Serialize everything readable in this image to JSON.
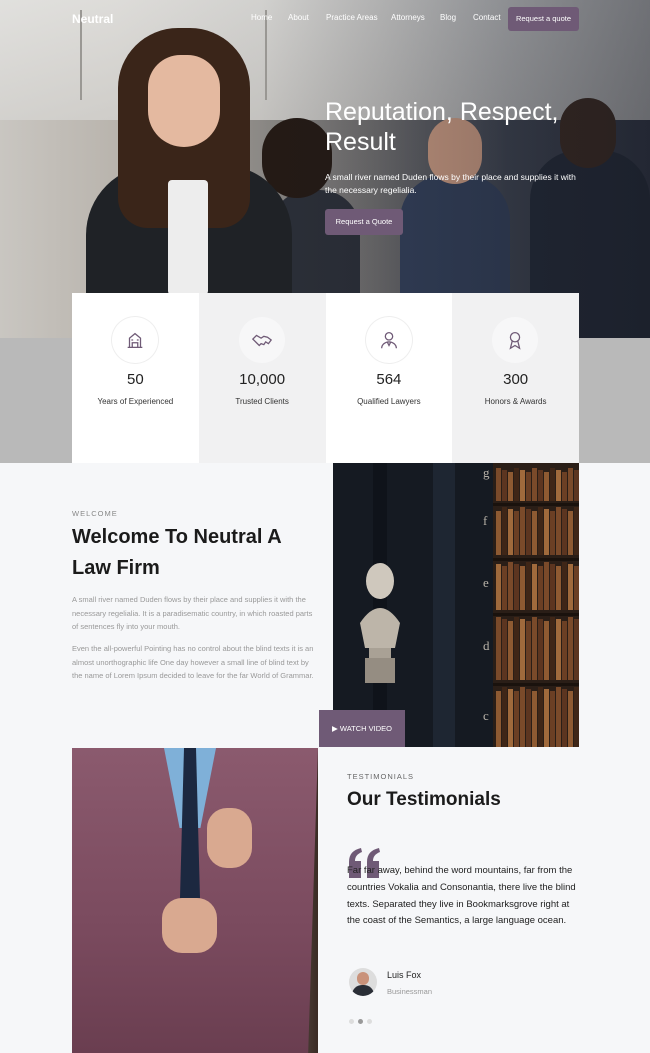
{
  "brand": {
    "name": "Neutral",
    "accent": "#6f5a76"
  },
  "nav": {
    "links": [
      "Home",
      "About",
      "Practice Areas",
      "Attorneys",
      "Blog",
      "Contact"
    ],
    "cta": "Request a quote"
  },
  "hero": {
    "title": "Reputation, Respect, Result",
    "subtitle": "A small river named Duden flows by their place and supplies it with the necessary regelialia.",
    "button": "Request a Quote"
  },
  "stats": [
    {
      "icon": "building-icon",
      "value": "50",
      "label": "Years of Experienced"
    },
    {
      "icon": "handshake-icon",
      "value": "10,000",
      "label": "Trusted Clients"
    },
    {
      "icon": "lawyer-icon",
      "value": "564",
      "label": "Qualified Lawyers"
    },
    {
      "icon": "award-icon",
      "value": "300",
      "label": "Honors & Awards"
    }
  ],
  "welcome": {
    "eyebrow": "WELCOME",
    "title": "Welcome To Neutral A Law Firm",
    "paragraph1": "A small river named Duden flows by their place and supplies it with the necessary regelialia. It is a paradisematic country, in which roasted parts of sentences fly into your mouth.",
    "paragraph2": "Even the all-powerful Pointing has no control about the blind texts it is an almost unorthographic life One day however a small line of blind text by the name of Lorem Ipsum decided to leave for the far World of Grammar.",
    "watch_button": "WATCH VIDEO",
    "shelf_letters": [
      "g",
      "f",
      "e",
      "d",
      "c"
    ]
  },
  "testimonials": {
    "eyebrow": "TESTIMONIALS",
    "title": "Our Testimonials",
    "quote": "Far far away, behind the word mountains, far from the countries Vokalia and Consonantia, there live the blind texts. Separated they live in Bookmarksgrove right at the coast of the Semantics, a large language ocean.",
    "author": "Luis Fox",
    "role": "Businessman",
    "active_slide": 2
  }
}
